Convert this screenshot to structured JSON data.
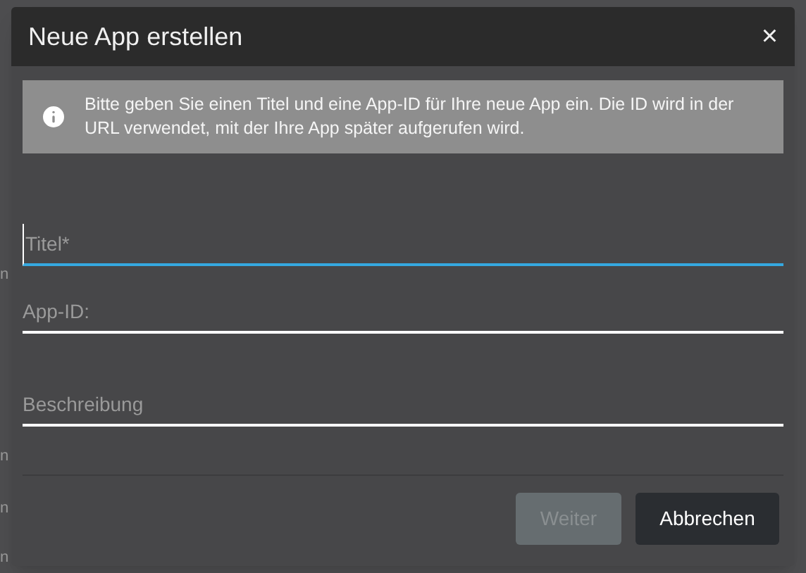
{
  "background_fragments": [
    "n",
    "n",
    "n",
    "n"
  ],
  "dialog": {
    "title": "Neue App erstellen",
    "close": "×",
    "info": "Bitte geben Sie einen Titel und eine App-ID für Ihre neue App ein. Die ID wird in der URL verwendet, mit der Ihre App später aufgerufen wird.",
    "fields": [
      {
        "placeholder": "Titel*",
        "focused": true
      },
      {
        "placeholder": "App-ID:",
        "focused": false
      },
      {
        "placeholder": "Beschreibung",
        "focused": false
      }
    ],
    "buttons": [
      {
        "label": "Weiter",
        "disabled": true
      },
      {
        "label": "Abbrechen",
        "disabled": false
      }
    ]
  }
}
